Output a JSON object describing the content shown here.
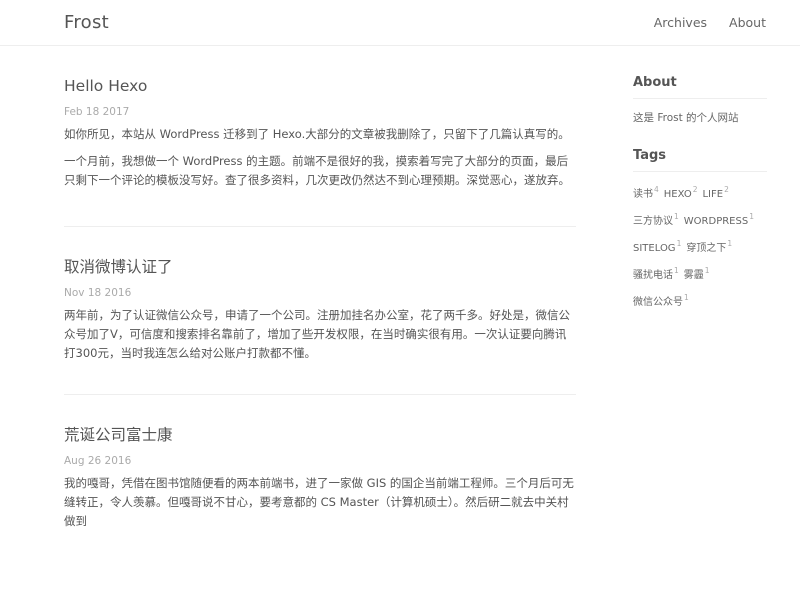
{
  "site": {
    "title": "Frost"
  },
  "nav": {
    "items": [
      "Archives",
      "About"
    ]
  },
  "posts": [
    {
      "title": "Hello Hexo",
      "date": "Feb 18 2017",
      "paragraphs": [
        "如你所见，本站从 WordPress 迁移到了 Hexo.大部分的文章被我删除了，只留下了几篇认真写的。",
        "一个月前，我想做一个 WordPress 的主题。前端不是很好的我，摸索着写完了大部分的页面，最后只剩下一个评论的模板没写好。查了很多资料，几次更改仍然达不到心理预期。深觉恶心，遂放弃。"
      ]
    },
    {
      "title": "取消微博认证了",
      "date": "Nov 18 2016",
      "paragraphs": [
        "两年前，为了认证微信公众号，申请了一个公司。注册加挂名办公室，花了两千多。好处是，微信公众号加了V，可信度和搜索排名靠前了，增加了些开发权限，在当时确实很有用。一次认证要向腾讯打300元，当时我连怎么给对公账户打款都不懂。"
      ]
    },
    {
      "title": "荒诞公司富士康",
      "date": "Aug 26 2016",
      "paragraphs": [
        "我的嘎哥，凭借在图书馆随便看的两本前端书，进了一家做 GIS 的国企当前端工程师。三个月后可无缝转正，令人羡慕。但嘎哥说不甘心，要考意都的 CS Master（计算机硕士）。然后研二就去中关村做到"
      ]
    }
  ],
  "sidebar": {
    "about": {
      "title": "About",
      "text": "这是 Frost 的个人网站"
    },
    "tags": {
      "title": "Tags",
      "items": [
        {
          "name": "读书",
          "count": "4"
        },
        {
          "name": "HEXO",
          "count": "2"
        },
        {
          "name": "LIFE",
          "count": "2"
        },
        {
          "name": "三方协议",
          "count": "1"
        },
        {
          "name": "WORDPRESS",
          "count": "1"
        },
        {
          "name": "SITELOG",
          "count": "1"
        },
        {
          "name": "穿顶之下",
          "count": "1"
        },
        {
          "name": "骚扰电话",
          "count": "1"
        },
        {
          "name": "雾霾",
          "count": "1"
        },
        {
          "name": "微信公众号",
          "count": "1"
        }
      ]
    }
  }
}
